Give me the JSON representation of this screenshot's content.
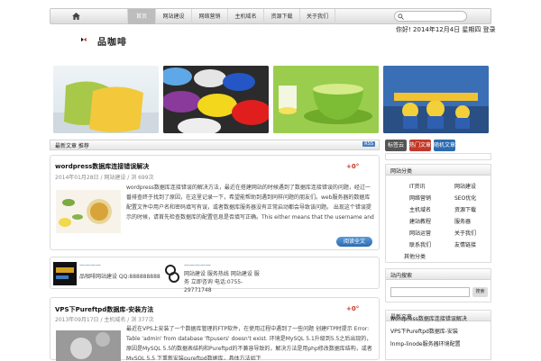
{
  "nav": {
    "items": [
      "首页",
      "网站建设",
      "网络营销",
      "主机域名",
      "资源下载",
      "关于我们"
    ]
  },
  "header": {
    "logo_text": "品咖啡",
    "date_line": "你好! 2014年12月4日 星期四   登录"
  },
  "featured": {
    "section_title": "最新文章 推荐",
    "rss_label": "RSS"
  },
  "posts": [
    {
      "title": "wordpress数据库连接错误解决",
      "meta": "2014年01月28日 / 网站建设 / 浏 699次",
      "score": "+0°",
      "excerpt": "wordpress数据库连接错误的解决方法，最近在搭建网站的时候遇到了数据库连接错误的问题，经过一番排查终于找到了原因，在这里记录一下，希望能帮助到遇到同样问题的朋友们。web服务器的数据库配置文件中用户名和密码填写有误，或者数据库服务器没有正常启动都会导致该问题。 出现这个错误提示的时候，请首先检查数据库的配置信息是否填写正确。This either means that the username and password information in your wp-config.php file is incorrect ...",
      "more": "阅读全文"
    },
    {
      "title": "VPS下Pureftpd数据库-安装方法",
      "meta": "2013年09月17日 / 主机域名 / 浏 377次",
      "score": "+0°",
      "excerpt": "最近在VPS上安装了一个数据库管理的FTP软件，在使用过程中遇到了一些问题 创建FTP时提示 Error: Table 'admin' from database 'ftpusers' doesn't exist.   环境是MySQL 5.1升级到5.5之后出现的，原因是MySQL 5.5的数据表结构和Pureftpd的不兼容导致的，解决方法是用php修改数据库结构，或者 MySQL 5.5 下重新安装pureftpd数据库，具体方法如下"
    }
  ],
  "ads": {
    "ad1_link": "————",
    "ad1_text": "品咖啡网站建设 QQ:888888888",
    "ad2_link": "—————",
    "ad2_text": "网站建设 服务热线 网站建设 服务 立即咨询 电话:0755-29771748"
  },
  "sidebar": {
    "tag_buttons": [
      "标签云",
      "热门文章",
      "随机文章"
    ],
    "categories_title": "网站分类",
    "categories": [
      "IT资讯",
      "网站建设",
      "网络营销",
      "SEO优化",
      "主机域名",
      "资源下载",
      "建站教程",
      "服务器",
      "网站运营",
      "关于我们",
      "联系我们",
      "友情链接",
      "其他分类"
    ],
    "search_title": "站内搜索",
    "search_button": "搜索",
    "recent_title": "最新文章",
    "recent": [
      "wordpress数据库连接错误解决",
      "VPS下Pureftpd数据库-安装",
      "lnmp-linode服务器环境配置"
    ]
  }
}
